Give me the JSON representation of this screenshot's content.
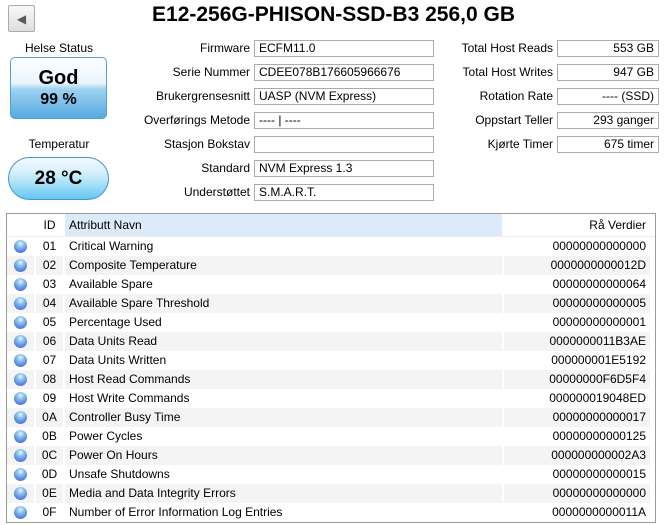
{
  "window": {
    "title": "E12-256G-PHISON-SSD-B3 256,0 GB",
    "back_icon": "◀"
  },
  "colors": {
    "health_good_blue": "#56abe0",
    "temp_pill_blue": "#66c6f0",
    "header_highlight": "#dceafa",
    "row_stripe": "#f4f4f4",
    "status_dot_blue": "#5f8de4"
  },
  "left_panel": {
    "health_label": "Helse Status",
    "health_status": "God",
    "health_percent": "99 %",
    "temp_label": "Temperatur",
    "temp_value": "28 °C"
  },
  "fields_mid": [
    {
      "label": "Firmware",
      "value": "ECFM11.0"
    },
    {
      "label": "Serie Nummer",
      "value": "CDEE078B176605966676"
    },
    {
      "label": "Brukergrensesnitt",
      "value": "UASP (NVM Express)"
    },
    {
      "label": "Overførings Metode",
      "value": "---- | ----"
    },
    {
      "label": "Stasjon Bokstav",
      "value": ""
    },
    {
      "label": "Standard",
      "value": "NVM Express 1.3"
    },
    {
      "label": "Understøttet",
      "value": "S.M.A.R.T."
    }
  ],
  "fields_right": [
    {
      "label": "Total Host Reads",
      "value": "553 GB"
    },
    {
      "label": "Total Host Writes",
      "value": "947 GB"
    },
    {
      "label": "Rotation Rate",
      "value": "---- (SSD)"
    },
    {
      "label": "Oppstart Teller",
      "value": "293 ganger"
    },
    {
      "label": "Kjørte Timer",
      "value": "675 timer"
    }
  ],
  "table": {
    "headers": {
      "id": "ID",
      "name": "Attributt Navn",
      "raw": "Rå Verdier"
    },
    "rows": [
      {
        "id": "01",
        "name": "Critical Warning",
        "raw": "00000000000000"
      },
      {
        "id": "02",
        "name": "Composite Temperature",
        "raw": "0000000000012D"
      },
      {
        "id": "03",
        "name": "Available Spare",
        "raw": "00000000000064"
      },
      {
        "id": "04",
        "name": "Available Spare Threshold",
        "raw": "00000000000005"
      },
      {
        "id": "05",
        "name": "Percentage Used",
        "raw": "00000000000001"
      },
      {
        "id": "06",
        "name": "Data Units Read",
        "raw": "0000000011B3AE"
      },
      {
        "id": "07",
        "name": "Data Units Written",
        "raw": "000000001E5192"
      },
      {
        "id": "08",
        "name": "Host Read Commands",
        "raw": "00000000F6D5F4"
      },
      {
        "id": "09",
        "name": "Host Write Commands",
        "raw": "000000019048ED"
      },
      {
        "id": "0A",
        "name": "Controller Busy Time",
        "raw": "00000000000017"
      },
      {
        "id": "0B",
        "name": "Power Cycles",
        "raw": "00000000000125"
      },
      {
        "id": "0C",
        "name": "Power On Hours",
        "raw": "000000000002A3"
      },
      {
        "id": "0D",
        "name": "Unsafe Shutdowns",
        "raw": "00000000000015"
      },
      {
        "id": "0E",
        "name": "Media and Data Integrity Errors",
        "raw": "00000000000000"
      },
      {
        "id": "0F",
        "name": "Number of Error Information Log Entries",
        "raw": "0000000000011A"
      }
    ]
  }
}
